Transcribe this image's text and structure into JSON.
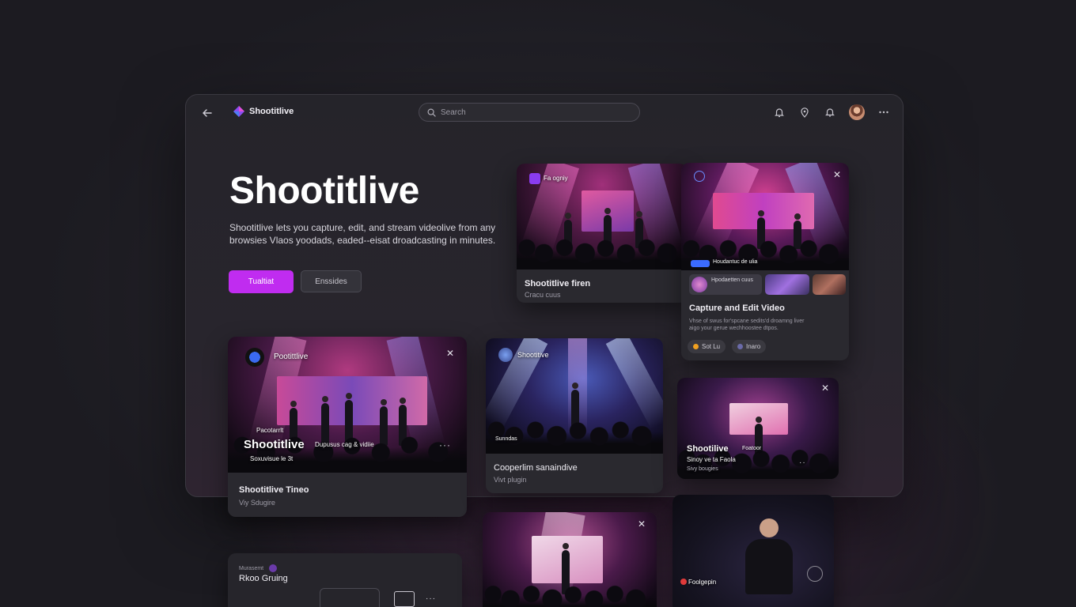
{
  "app": {
    "name": "Shootitlive",
    "search_placeholder": "Search"
  },
  "hero": {
    "title": "Shootitlive",
    "description": "Shootitlive lets you capture, edit, and stream videolive from any browsies Vlaos yoodads, eaded--eisat droadcasting in minutes.",
    "primary_button": "Tualtiat",
    "secondary_button": "Enssides"
  },
  "cards": {
    "concert_top": {
      "badge": "Fa ogniy",
      "title": "Shootitlive firen",
      "subtitle": "Cracu cuus"
    },
    "capture": {
      "overlay_line": "Houdantuc de ulia",
      "mini_label": "Hpodaetten cuus",
      "title": "Capture and Edit Video",
      "description": "Vhse of swus for'spcane sedits'd droamng liver aigo your gerue wechhoostee dtpos.",
      "chip1": "Sot Lu",
      "chip2": "Inaro",
      "chip1_color": "#f0a020",
      "chip2_color": "#6a6aa8"
    },
    "band": {
      "badge": "Pootittlive",
      "tag": "Pacotarrlt",
      "overlay_title": "Shootitlive",
      "overlay_extra": "Dupusus cag & vidiie",
      "overlay_sub": "Soxuvisue le 3t",
      "title": "Shootitlive Tineo",
      "subtitle": "Viy Sdugire"
    },
    "guitar": {
      "badge": "Shootitive",
      "overlay": "Sunndas",
      "title": "Cooperlim sanaindive",
      "subtitle": "Vivt plugin"
    },
    "singer": {
      "overlay_title": "Shootilive",
      "overlay_tag": "Foatoor",
      "overlay_sub": "Sinoy ve ta Faola",
      "subtitle": "Sivy bougies"
    },
    "bottom_left": {
      "label_small": "Murasemt",
      "title": "Rkoo Gruing"
    },
    "speaker": {
      "tag": "Foolgepin"
    }
  },
  "colors": {
    "accent": "#c02cf0",
    "live_blue": "#3b6bff"
  }
}
